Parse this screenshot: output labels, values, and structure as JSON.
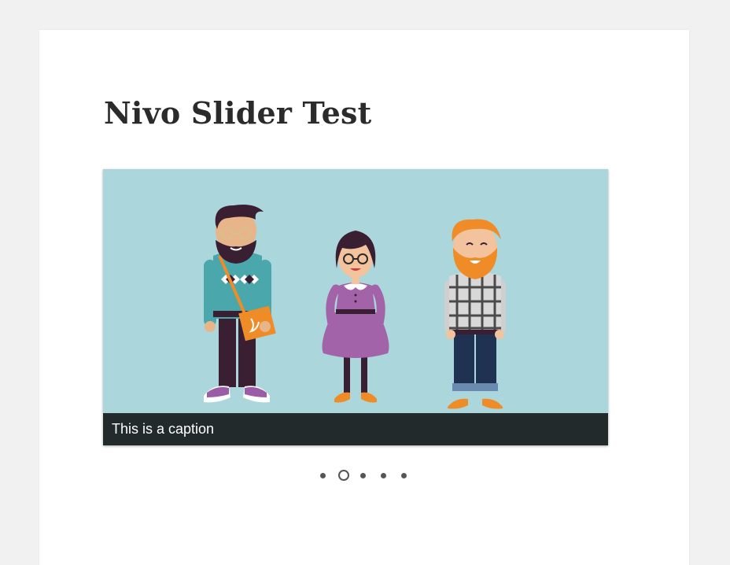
{
  "page": {
    "title": "Nivo Slider Test",
    "background_color": "#f1f1f1",
    "card_color": "#ffffff"
  },
  "slider": {
    "background_color": "#abd6db",
    "caption": "This is a caption",
    "caption_background": "#232a2b",
    "image": {
      "description_icons": [
        "bearded-hipster-man-icon",
        "woman-purple-dress-icon",
        "ginger-bearded-man-icon"
      ]
    },
    "slides_count": 5,
    "active_slide": 2
  }
}
